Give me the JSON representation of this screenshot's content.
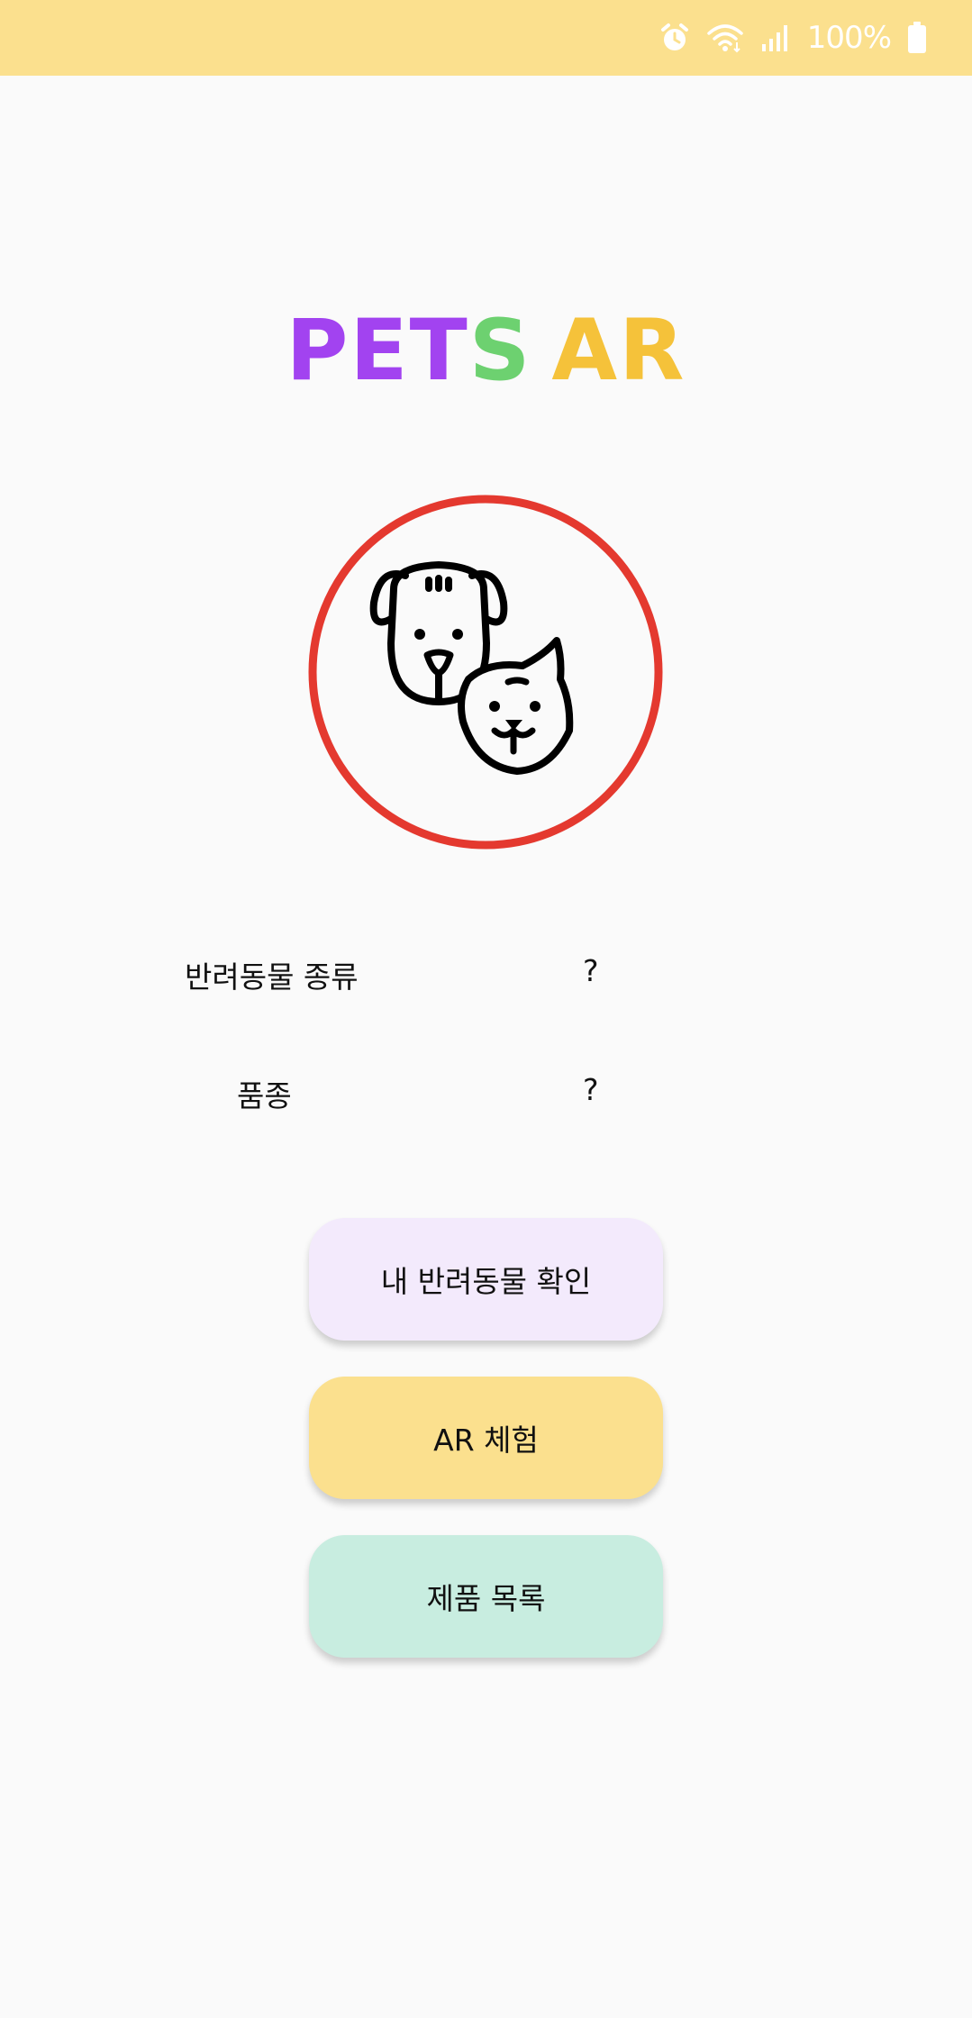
{
  "status_bar": {
    "battery_text": "100%",
    "icons": [
      "alarm-icon",
      "wifi-icon",
      "signal-icon",
      "battery-icon"
    ],
    "background": "#fbe08e"
  },
  "logo": {
    "letters": [
      {
        "char": "P",
        "color": "#a243f0"
      },
      {
        "char": "E",
        "color": "#a243f0"
      },
      {
        "char": "T",
        "color": "#a243f0"
      },
      {
        "char": "S",
        "color": "#6dd170"
      },
      {
        "char": " ",
        "color": "#000000"
      },
      {
        "char": "A",
        "color": "#f5c23a"
      },
      {
        "char": "R",
        "color": "#f5c23a"
      }
    ]
  },
  "emblem": {
    "ring_color": "#e4392f",
    "icon": "dog-and-cat-icon"
  },
  "info": {
    "pet_type_label": "반려동물 종류",
    "pet_type_value": "?",
    "breed_label": "품종",
    "breed_value": "?"
  },
  "buttons": {
    "check_pet": {
      "label": "내 반려동물 확인",
      "color": "#f3eafc"
    },
    "ar_experience": {
      "label": "AR 체험",
      "color": "#fbe08e"
    },
    "product_list": {
      "label": "제품 목록",
      "color": "#c8ede0"
    }
  }
}
